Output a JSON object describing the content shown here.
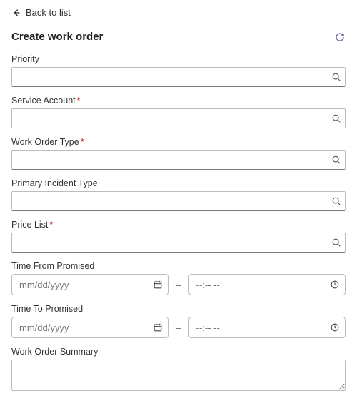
{
  "nav": {
    "back_label": "Back to list"
  },
  "header": {
    "title": "Create work order"
  },
  "fields": {
    "priority": {
      "label": "Priority",
      "value": ""
    },
    "service_account": {
      "label": "Service Account",
      "required": "*",
      "value": ""
    },
    "work_order_type": {
      "label": "Work Order Type",
      "required": "*",
      "value": ""
    },
    "primary_incident_type": {
      "label": "Primary Incident Type",
      "value": ""
    },
    "price_list": {
      "label": "Price List",
      "required": "*",
      "value": ""
    },
    "time_from": {
      "label": "Time From Promised",
      "date_placeholder": "mm/dd/yyyy",
      "time_placeholder": "--:-- --",
      "separator": "–"
    },
    "time_to": {
      "label": "Time To Promised",
      "date_placeholder": "mm/dd/yyyy",
      "time_placeholder": "--:-- --",
      "separator": "–"
    },
    "summary": {
      "label": "Work Order Summary",
      "value": ""
    }
  }
}
